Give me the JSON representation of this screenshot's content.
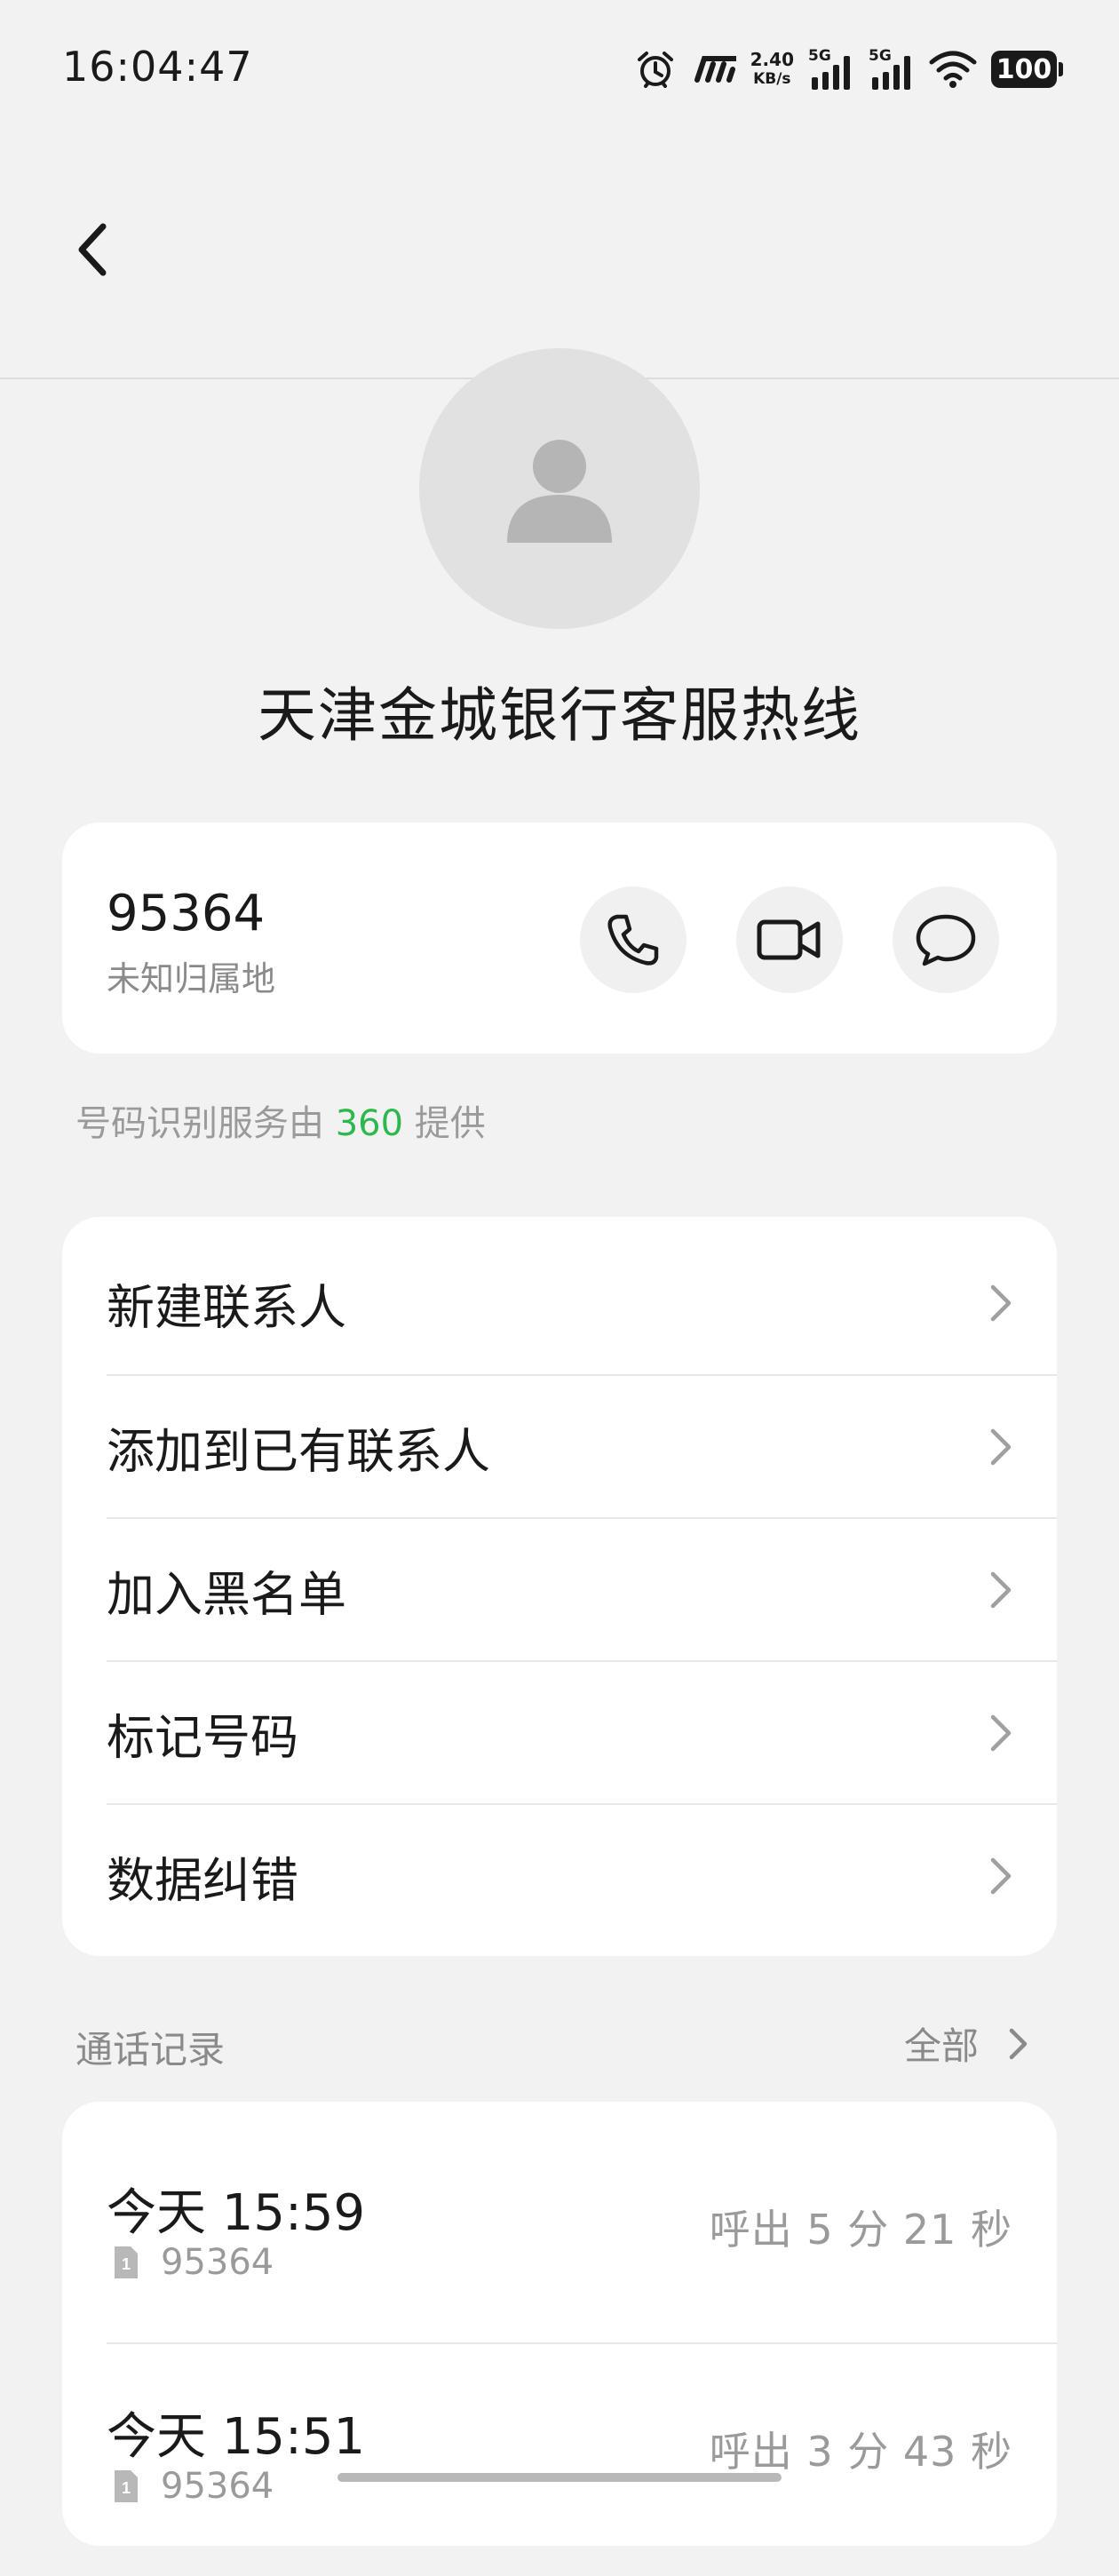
{
  "status_bar": {
    "time": "16:04:47",
    "net_speed_value": "2.40",
    "net_speed_unit": "KB/s",
    "sim1_label": "5G",
    "sim2_label": "5G",
    "battery": "100",
    "icons": [
      "alarm-icon",
      "hd-icon",
      "signal-icon",
      "wifi-icon",
      "battery-icon"
    ]
  },
  "header": {
    "back_icon": "chevron-left-icon"
  },
  "contact": {
    "name": "天津金城银行客服热线",
    "number": "95364",
    "location": "未知归属地"
  },
  "actions": {
    "icons": [
      "phone-icon",
      "video-icon",
      "message-icon"
    ]
  },
  "provider_note": {
    "prefix": "号码识别服务由",
    "brand": "360",
    "suffix": "提供",
    "brand_color": "#2db84d"
  },
  "menu": {
    "items": [
      {
        "label": "新建联系人"
      },
      {
        "label": "添加到已有联系人"
      },
      {
        "label": "加入黑名单"
      },
      {
        "label": "标记号码"
      },
      {
        "label": "数据纠错"
      }
    ]
  },
  "call_log": {
    "title": "通话记录",
    "see_all": "全部",
    "entries": [
      {
        "time": "今天 15:59",
        "sim": "1",
        "number": "95364",
        "duration": "呼出 5 分 21 秒"
      },
      {
        "time": "今天 15:51",
        "sim": "1",
        "number": "95364",
        "duration": "呼出 3 分 43 秒"
      }
    ]
  }
}
